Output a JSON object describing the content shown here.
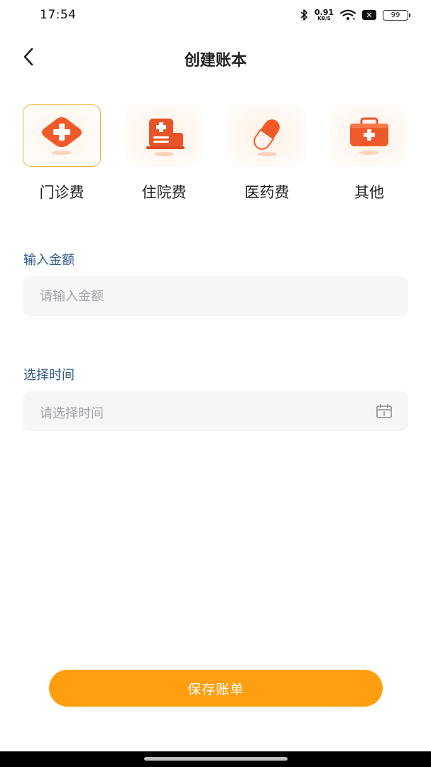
{
  "status_bar": {
    "time": "17:54",
    "net_speed_value": "0.91",
    "net_speed_unit": "KB/S",
    "x_badge": "✕",
    "battery": "99"
  },
  "header": {
    "title": "创建账本",
    "back_icon": "chevron-left-icon"
  },
  "categories": [
    {
      "label": "门诊费",
      "icon": "outpatient-cross-icon",
      "selected": true
    },
    {
      "label": "住院费",
      "icon": "hospital-icon",
      "selected": false
    },
    {
      "label": "医药费",
      "icon": "pill-capsule-icon",
      "selected": false
    },
    {
      "label": "其他",
      "icon": "first-aid-kit-icon",
      "selected": false
    }
  ],
  "form": {
    "amount": {
      "label": "输入金额",
      "placeholder": "请输入金额",
      "value": ""
    },
    "time": {
      "label": "选择时间",
      "placeholder": "请选择时间",
      "value": "",
      "icon": "calendar-icon"
    }
  },
  "save_button": {
    "label": "保存账单"
  },
  "colors": {
    "accent": "#ff9f10",
    "icon_orange": "#f05a2a",
    "label_blue": "#2f5a8c",
    "selected_border": "#f0b23a",
    "input_bg": "#f4f6f8"
  }
}
